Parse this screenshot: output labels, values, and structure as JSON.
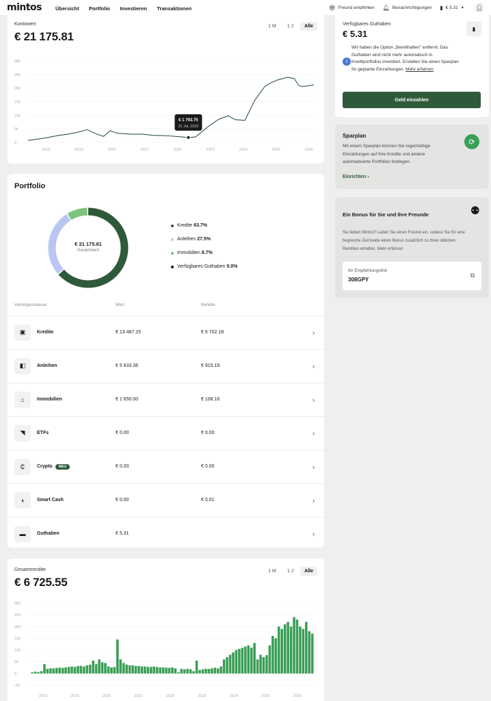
{
  "nav": {
    "logo": "mintos",
    "items": [
      "Übersicht",
      "Portfolio",
      "Investieren",
      "Transaktionen"
    ],
    "refer": "Freund empfehlen",
    "notifications": "Benachrichtigungen",
    "balance": "€ 5.31"
  },
  "account": {
    "label": "Kontowert",
    "value": "€ 21 175.81",
    "ranges": [
      "1 M",
      "1 J",
      "Alle"
    ],
    "tooltip_value": "€ 1 793.75",
    "tooltip_date": "31 Jul, 2022"
  },
  "available": {
    "label": "Verfügbares Guthaben",
    "value": "€ 5.31",
    "info_line1": "Wir haben die Option „Bereithalten\" entfernt. Das",
    "info_line2": "Guthaben wird nicht mehr automatisch in",
    "info_line3": "Kreditportfolios investiert. Erstellen Sie einen Sparplan",
    "info_line4": "für geplante Einzahlungen.",
    "info_link": "Mehr erfahren",
    "button": "Geld einzahlen"
  },
  "sparplan": {
    "title": "Sparplan",
    "line1": "Mit einem Sparplan können Sie regelmäßige",
    "line2": "Einzahlungen auf Ihre Kredite und andere",
    "line3": "automatisierte Portfolios festlegen.",
    "link": "Einrichten"
  },
  "bonus": {
    "title": "Ein Bonus für Sie und Ihre Freunde",
    "line1": "Sie lieben Mintos? Laden Sie einen Freund ein, sodass Sie für eine",
    "line2": "begrenzte Zeit beide einen Bonus zusätzlich zu Ihren üblichen",
    "line3": "Renditen erhalten.",
    "more": "Mehr erfahren",
    "link_label": "Ihr Empfehlungslink",
    "link_value": "308GPY"
  },
  "portfolio": {
    "title": "Portfolio",
    "center_value": "€ 21 175.81",
    "center_label": "Gesamtwert",
    "legend": [
      {
        "name": "Kredite",
        "pct": "63.7%",
        "color": "#2f5a3a"
      },
      {
        "name": "Anleihen",
        "pct": "27.5%",
        "color": "#b9c6f2"
      },
      {
        "name": "Immobilien",
        "pct": "8.7%",
        "color": "#7cc47e"
      },
      {
        "name": "Verfügbares Guthaben",
        "pct": "0.0%",
        "color": "#1a1a1a"
      }
    ],
    "columns": [
      "Vermögensklasse",
      "Wert",
      "Rendite"
    ],
    "rows": [
      {
        "name": "Kredite",
        "value": "€ 13 487.15",
        "ret": "€ 5 702.18",
        "icon": "wallet-stack-icon",
        "glyph": "▣"
      },
      {
        "name": "Anleihen",
        "value": "€ 5 833.36",
        "ret": "€ 915.19",
        "icon": "bond-icon",
        "glyph": "◧"
      },
      {
        "name": "Immobilien",
        "value": "€ 1 650.00",
        "ret": "€ 108.16",
        "icon": "house-icon",
        "glyph": "⌂"
      },
      {
        "name": "ETFs",
        "value": "€ 0.00",
        "ret": "€ 0.00",
        "icon": "etf-icon",
        "glyph": "◥"
      },
      {
        "name": "Crypto",
        "value": "€ 0.00",
        "ret": "€ 0.00",
        "icon": "crypto-icon",
        "glyph": "₵",
        "badge": "NEU"
      },
      {
        "name": "Smart Cash",
        "value": "€ 0.00",
        "ret": "€ 0.01",
        "icon": "smart-cash-icon",
        "glyph": "◖"
      },
      {
        "name": "Guthaben",
        "value": "€ 5.31",
        "ret": "",
        "icon": "wallet-icon",
        "glyph": "▬"
      }
    ]
  },
  "returns": {
    "label": "Gesamtrendite",
    "value": "€ 6 725.55",
    "ranges": [
      "1 M",
      "1 J",
      "Alle"
    ]
  },
  "colors": {
    "accent": "#2f5a3a",
    "bar": "#3a9e56",
    "line": "#2f5a3a"
  },
  "chart_data": [
    {
      "type": "line",
      "ylabel": "",
      "ylim": [
        0,
        30000
      ],
      "yticks": [
        "0",
        "5k",
        "10k",
        "15k",
        "20k",
        "25k",
        "30k"
      ],
      "xticks": [
        "2018",
        "2019",
        "2020",
        "2021",
        "2022",
        "2023",
        "2024",
        "2025",
        "2026"
      ],
      "x": [
        2017.7,
        2018.0,
        2018.3,
        2018.6,
        2018.9,
        2019.2,
        2019.5,
        2019.8,
        2020.0,
        2020.2,
        2020.4,
        2020.6,
        2020.9,
        2021.2,
        2021.5,
        2021.8,
        2022.0,
        2022.3,
        2022.58,
        2022.8,
        2023.0,
        2023.2,
        2023.5,
        2023.8,
        2024.0,
        2024.3,
        2024.6,
        2024.9,
        2025.1,
        2025.3,
        2025.6,
        2025.8,
        2025.95,
        2026.1,
        2026.4
      ],
      "values": [
        700,
        1200,
        1800,
        2500,
        3000,
        3700,
        4700,
        3000,
        2200,
        4300,
        3400,
        3200,
        3000,
        3000,
        2600,
        2500,
        2400,
        2100,
        1794,
        2000,
        4000,
        6000,
        8500,
        9800,
        8400,
        8100,
        15500,
        20500,
        22000,
        23000,
        24000,
        23500,
        20800,
        20600,
        21200
      ]
    },
    {
      "type": "bar",
      "ylim": [
        -50,
        300
      ],
      "yticks": [
        "-50",
        "0",
        "50",
        "100",
        "150",
        "200",
        "250",
        "300"
      ],
      "xticks": [
        "2019",
        "2019",
        "2020",
        "2021",
        "2022",
        "2023",
        "2024",
        "2025",
        "2026"
      ],
      "values": [
        5,
        8,
        6,
        10,
        40,
        20,
        22,
        22,
        24,
        25,
        24,
        26,
        28,
        30,
        28,
        32,
        33,
        30,
        35,
        38,
        55,
        40,
        60,
        48,
        45,
        30,
        26,
        28,
        145,
        60,
        45,
        38,
        35,
        35,
        32,
        32,
        30,
        30,
        28,
        28,
        30,
        28,
        26,
        26,
        25,
        24,
        26,
        22,
        5,
        20,
        18,
        20,
        18,
        10,
        55,
        15,
        18,
        20,
        20,
        22,
        25,
        22,
        30,
        60,
        70,
        80,
        90,
        100,
        105,
        110,
        115,
        120,
        110,
        130,
        60,
        80,
        70,
        78,
        120,
        160,
        150,
        200,
        190,
        210,
        220,
        200,
        240,
        230,
        200,
        190,
        220,
        180,
        170
      ],
      "bar_labels_visible": false
    }
  ]
}
